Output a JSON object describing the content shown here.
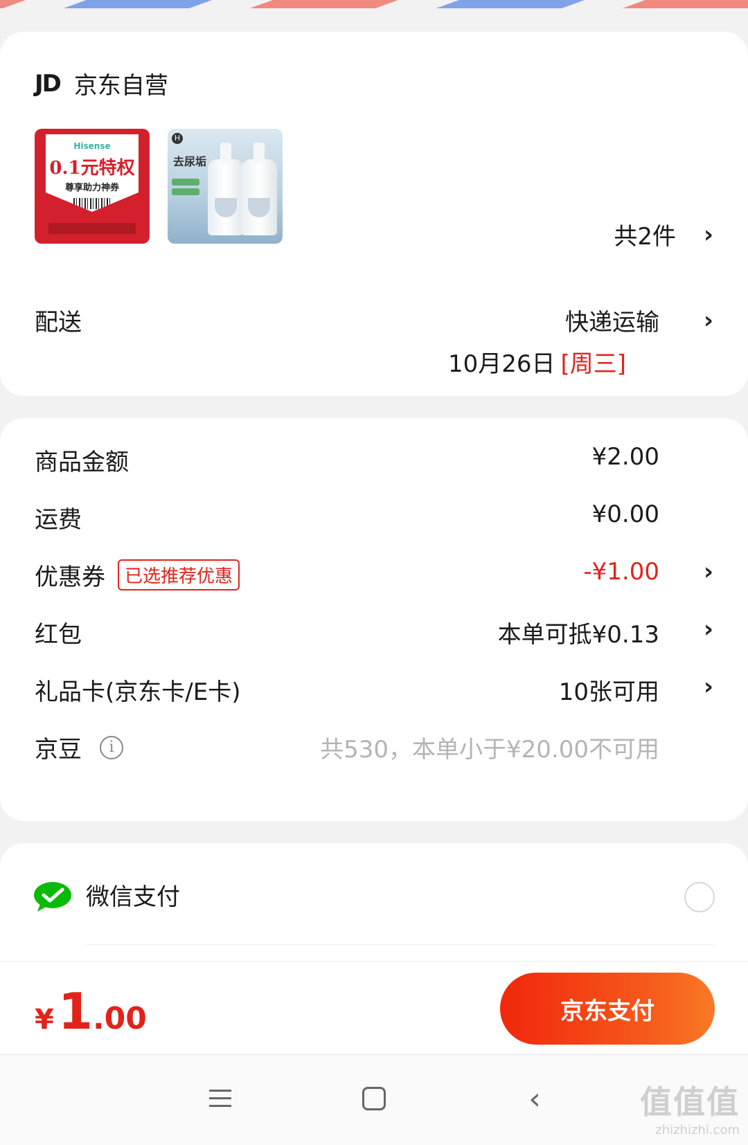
{
  "shop": {
    "logo": "JD",
    "name": "京东自营",
    "items_count": "共2件",
    "thumb_coupon": {
      "brand": "Hisense",
      "headline": "0.1元特权",
      "subline": "尊享助力神券"
    },
    "thumb_cleaner": {
      "brand_badge": "H",
      "headline": "去尿垢"
    }
  },
  "delivery": {
    "label": "配送",
    "method": "快递运输",
    "date": "10月26日",
    "weekday": "[周三]"
  },
  "price": {
    "goods_label": "商品金额",
    "goods_value": "¥2.00",
    "shipping_label": "运费",
    "shipping_value": "¥0.00",
    "coupon_label": "优惠券",
    "coupon_tag": "已选推荐优惠",
    "coupon_value": "-¥1.00",
    "redpacket_label": "红包",
    "redpacket_value": "本单可抵¥0.13",
    "giftcard_label": "礼品卡(京东卡/E卡)",
    "giftcard_value": "10张可用",
    "jingdou_label": "京豆",
    "jingdou_value": "共530，本单小于¥20.00不可用"
  },
  "payment": {
    "wechat_label": "微信支付",
    "wechat_selected": false
  },
  "footer": {
    "total_currency": "¥",
    "total_int": "1",
    "total_dec": ".00",
    "pay_button": "京东支付"
  },
  "watermark": {
    "text": "值值值",
    "url": "zhizhizhi.com"
  },
  "colors": {
    "accent": "#e2231a",
    "wechat": "#09bb07"
  },
  "icons": {
    "chevron": "chevron-right-icon",
    "info": "info-icon",
    "wechat": "wechat-pay-icon"
  }
}
